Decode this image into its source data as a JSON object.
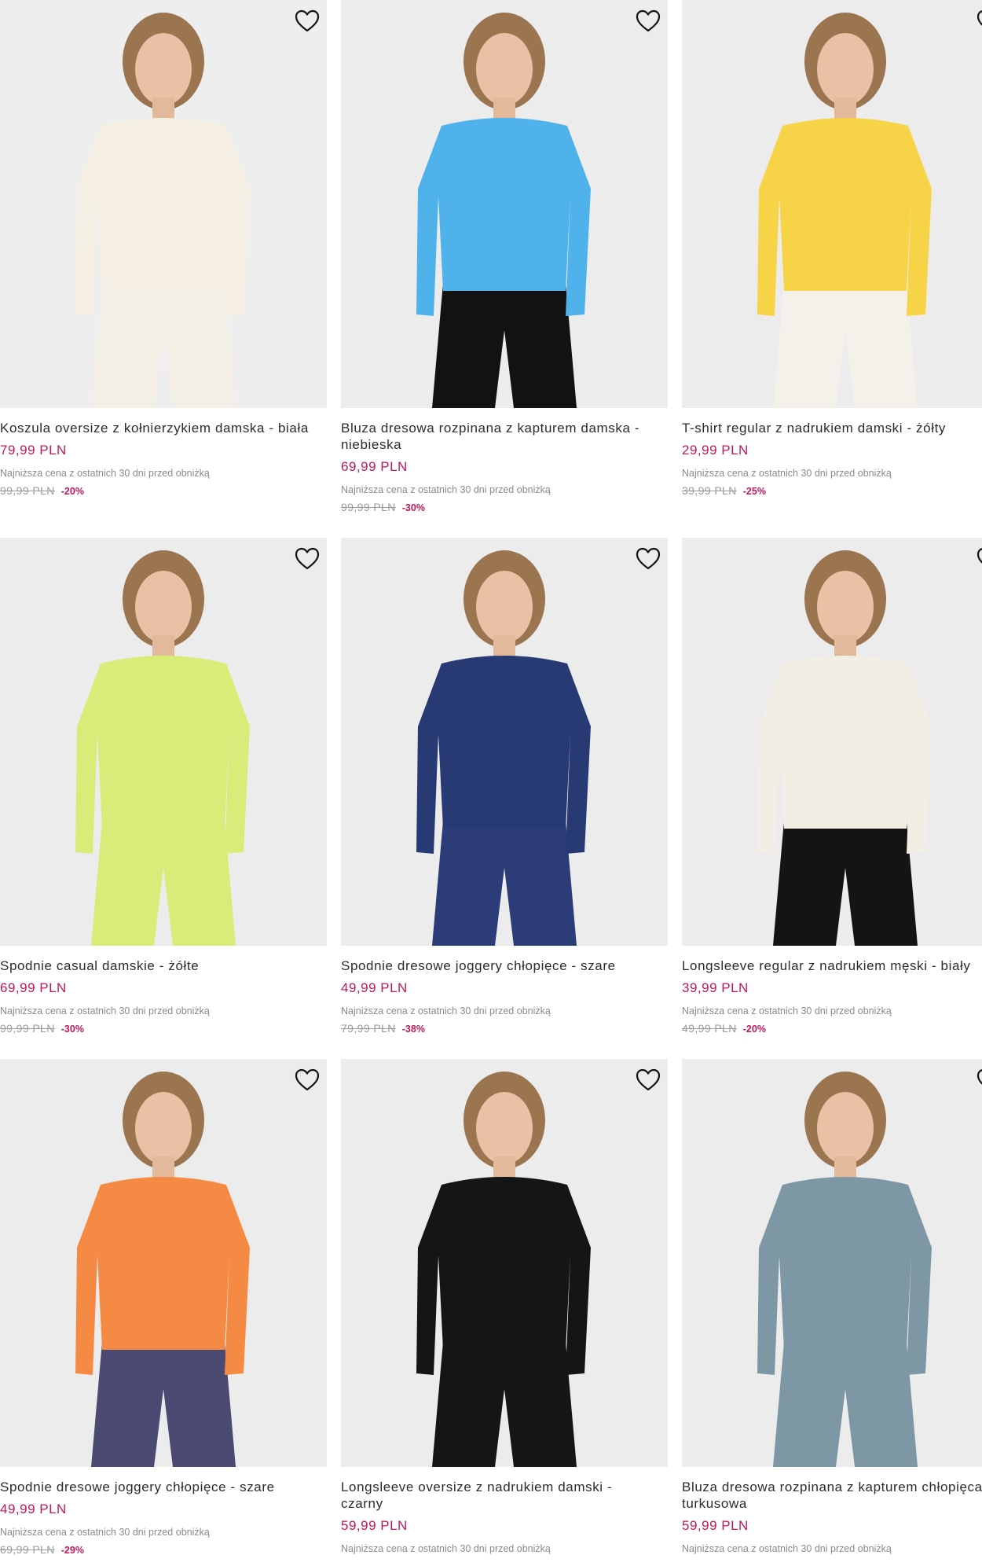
{
  "products": [
    {
      "name": "Koszula oversize z kołnierzykiem damska - biała",
      "price": "79,99 PLN",
      "lowest_label": "Najniższa cena z ostatnich 30 dni przed obniżką",
      "old_price": "99,99 PLN",
      "discount": "-20%",
      "background": "#eeeeee",
      "garment_color": "#f4efe2",
      "bottom_color": "#f3efe6"
    },
    {
      "name": "Bluza dresowa rozpinana z kapturem damska - niebieska",
      "price": "69,99 PLN",
      "lowest_label": "Najniższa cena z ostatnich 30 dni przed obniżką",
      "old_price": "99,99 PLN",
      "discount": "-30%",
      "background": "#ececec",
      "garment_color": "#4fb2ea",
      "bottom_color": "#121212"
    },
    {
      "name": "T-shirt regular z nadrukiem damski - żółty",
      "price": "29,99 PLN",
      "lowest_label": "Najniższa cena z ostatnich 30 dni przed obniżką",
      "old_price": "39,99 PLN",
      "discount": "-25%",
      "background": "#ececec",
      "garment_color": "#f7d347",
      "bottom_color": "#f4f1ea"
    },
    {
      "name": "Spodnie casual damskie - żółte",
      "price": "69,99 PLN",
      "lowest_label": "Najniższa cena z ostatnich 30 dni przed obniżką",
      "old_price": "99,99 PLN",
      "discount": "-30%",
      "background": "#ececec",
      "garment_color": "#d8ec7a",
      "bottom_color": "#d8ec7a"
    },
    {
      "name": "Spodnie dresowe joggery chłopięce - szare",
      "price": "49,99 PLN",
      "lowest_label": "Najniższa cena z ostatnich 30 dni przed obniżką",
      "old_price": "79,99 PLN",
      "discount": "-38%",
      "background": "#ececec",
      "garment_color": "#283a73",
      "bottom_color": "#2c3c78"
    },
    {
      "name": "Longsleeve regular z nadrukiem męski - biały",
      "price": "39,99 PLN",
      "lowest_label": "Najniższa cena z ostatnich 30 dni przed obniżką",
      "old_price": "49,99 PLN",
      "discount": "-20%",
      "background": "#ececec",
      "garment_color": "#f2eee6",
      "bottom_color": "#141414"
    },
    {
      "name": "Spodnie dresowe joggery chłopięce - szare",
      "price": "49,99 PLN",
      "lowest_label": "Najniższa cena z ostatnich 30 dni przed obniżką",
      "old_price": "69,99 PLN",
      "discount": "-29%",
      "background": "#ececec",
      "garment_color": "#f58a44",
      "bottom_color": "#4a4a72"
    },
    {
      "name": "Longsleeve oversize z nadrukiem damski - czarny",
      "price": "59,99 PLN",
      "lowest_label": "Najniższa cena z ostatnich 30 dni przed obniżką",
      "background": "#ececec",
      "garment_color": "#151515",
      "bottom_color": "#151515"
    },
    {
      "name": "Bluza dresowa rozpinana z kapturem chłopięca - turkusowa",
      "price": "59,99 PLN",
      "lowest_label": "Najniższa cena z ostatnich 30 dni przed obniżką",
      "background": "#ececec",
      "garment_color": "#7d98a4",
      "bottom_color": "#7d98a4"
    }
  ],
  "icons": {
    "favorite": "heart-outline-icon"
  },
  "colors": {
    "price": "#c2185b",
    "strikethrough": "#9a9a9a",
    "muted": "#8a8a8a"
  }
}
